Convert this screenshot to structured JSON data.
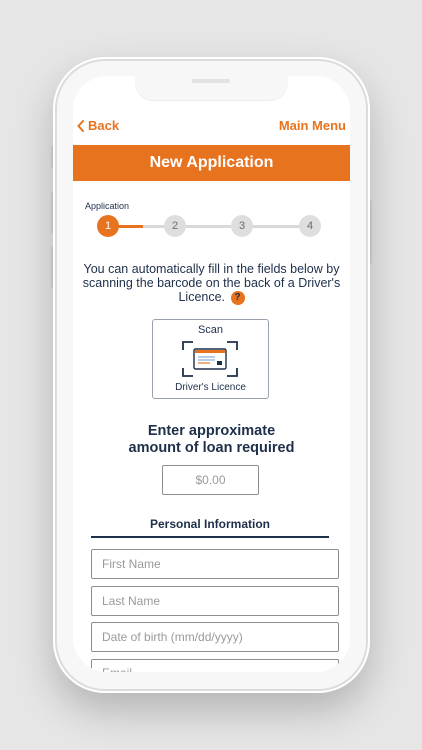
{
  "nav": {
    "back_label": "Back",
    "menu_label": "Main Menu"
  },
  "header": {
    "title": "New Application"
  },
  "progress": {
    "caption": "Application",
    "current_step": 1,
    "steps": [
      "1",
      "2",
      "3",
      "4"
    ]
  },
  "scan_info": {
    "text": "You can automatically fill in the fields below by scanning the barcode on the back of a Driver's Licence.",
    "help_icon": "?"
  },
  "scan_card": {
    "title": "Scan",
    "subtitle": "Driver's Licence",
    "icon": "id-card-scan-icon"
  },
  "loan": {
    "title_line1": "Enter approximate",
    "title_line2": "amount of loan required",
    "amount_placeholder": "$0.00"
  },
  "personal": {
    "title": "Personal Information",
    "fields": [
      "First Name",
      "Last Name",
      "Date of birth (mm/dd/yyyy)",
      "Email"
    ]
  },
  "colors": {
    "accent": "#e8731f",
    "navy": "#1e2f4a",
    "inactive_step": "#dedede"
  }
}
